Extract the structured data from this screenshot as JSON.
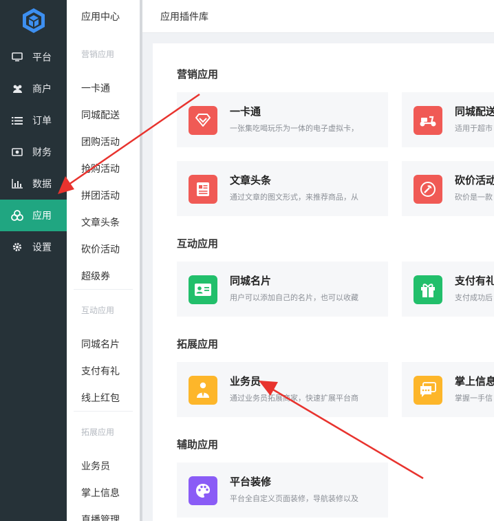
{
  "nav": {
    "items": [
      {
        "label": "平台",
        "icon": "monitor-icon"
      },
      {
        "label": "商户",
        "icon": "users-icon"
      },
      {
        "label": "订单",
        "icon": "list-icon"
      },
      {
        "label": "财务",
        "icon": "money-icon"
      },
      {
        "label": "数据",
        "icon": "bar-chart-icon"
      },
      {
        "label": "应用",
        "icon": "apps-icon",
        "active": true
      },
      {
        "label": "设置",
        "icon": "gear-icon"
      }
    ]
  },
  "submenu": {
    "title": "应用中心",
    "groups": [
      {
        "title": "营销应用",
        "items": [
          "一卡通",
          "同城配送",
          "团购活动",
          "抢购活动",
          "拼团活动",
          "文章头条",
          "砍价活动",
          "超级券"
        ]
      },
      {
        "title": "互动应用",
        "items": [
          "同城名片",
          "支付有礼",
          "线上红包"
        ]
      },
      {
        "title": "拓展应用",
        "items": [
          "业务员",
          "掌上信息",
          "直播管理"
        ]
      }
    ]
  },
  "header": {
    "title": "应用插件库"
  },
  "sections": [
    {
      "title": "营销应用",
      "cards": [
        {
          "name": "一卡通",
          "desc": "一张集吃喝玩乐为一体的电子虚拟卡，",
          "icon": "diamond-icon",
          "color": "#f05a55"
        },
        {
          "name": "同城配送",
          "desc": "适用于超市",
          "icon": "scooter-icon",
          "color": "#f05a55"
        },
        {
          "name": "文章头条",
          "desc": "通过文章的图文形式，来推荐商品，从",
          "icon": "article-icon",
          "color": "#f05a55"
        },
        {
          "name": "砍价活动",
          "desc": "砍价是一款",
          "icon": "axe-icon",
          "color": "#f05a55"
        }
      ]
    },
    {
      "title": "互动应用",
      "cards": [
        {
          "name": "同城名片",
          "desc": "用户可以添加自己的名片，也可以收藏",
          "icon": "id-card-icon",
          "color": "#22bf6b"
        },
        {
          "name": "支付有礼",
          "desc": "支付成功后",
          "icon": "gift-icon",
          "color": "#22bf6b"
        }
      ]
    },
    {
      "title": "拓展应用",
      "cards": [
        {
          "name": "业务员",
          "desc": "通过业务员拓展商家，快速扩展平台商",
          "icon": "salesman-icon",
          "color": "#fdb62a"
        },
        {
          "name": "掌上信息",
          "desc": "掌握一手信",
          "icon": "chat-icon",
          "color": "#fdb62a"
        }
      ]
    },
    {
      "title": "辅助应用",
      "cards": [
        {
          "name": "平台装修",
          "desc": "平台全自定义页面装修，导航装修以及",
          "icon": "palette-icon",
          "color": "#8a5cf6"
        }
      ]
    }
  ]
}
